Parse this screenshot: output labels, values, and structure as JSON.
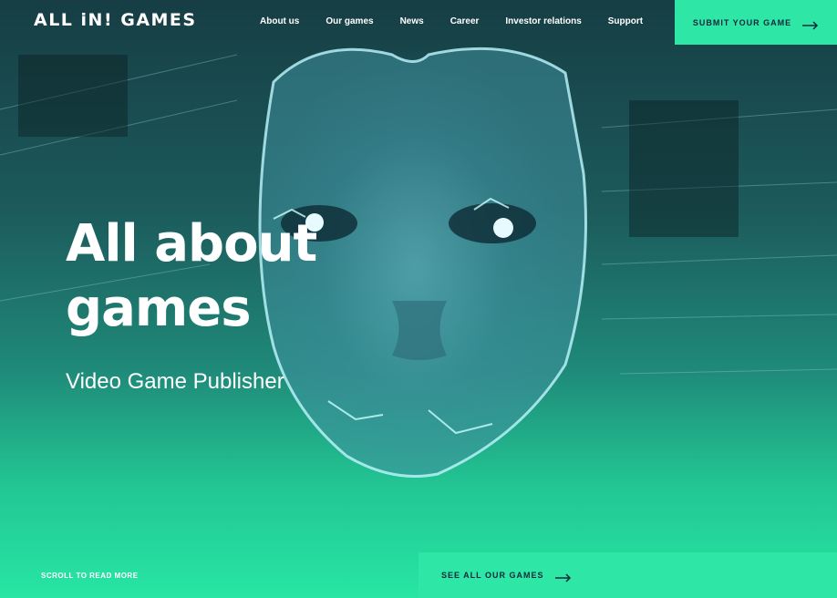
{
  "header": {
    "logo_text": "ALL iN! GAMES",
    "nav": [
      {
        "label": "About us"
      },
      {
        "label": "Our games"
      },
      {
        "label": "News"
      },
      {
        "label": "Career"
      },
      {
        "label": "Investor relations"
      },
      {
        "label": "Support"
      }
    ],
    "submit_label": "SUBMIT YOUR GAME",
    "submit_icon": "arrow-right-icon"
  },
  "hero": {
    "title_line1": "All about",
    "title_line2": "games",
    "subtitle": "Video Game Publisher",
    "background_image": "glowing-robot-face"
  },
  "footer": {
    "scroll_label": "SCROLL TO READ MORE",
    "see_all_label": "SEE ALL OUR GAMES",
    "see_all_icon": "arrow-right-icon"
  },
  "colors": {
    "accent": "#2ee6a5",
    "button_text": "#14293b",
    "bg_dark": "#163e44",
    "glow": "#7ff0ff"
  }
}
